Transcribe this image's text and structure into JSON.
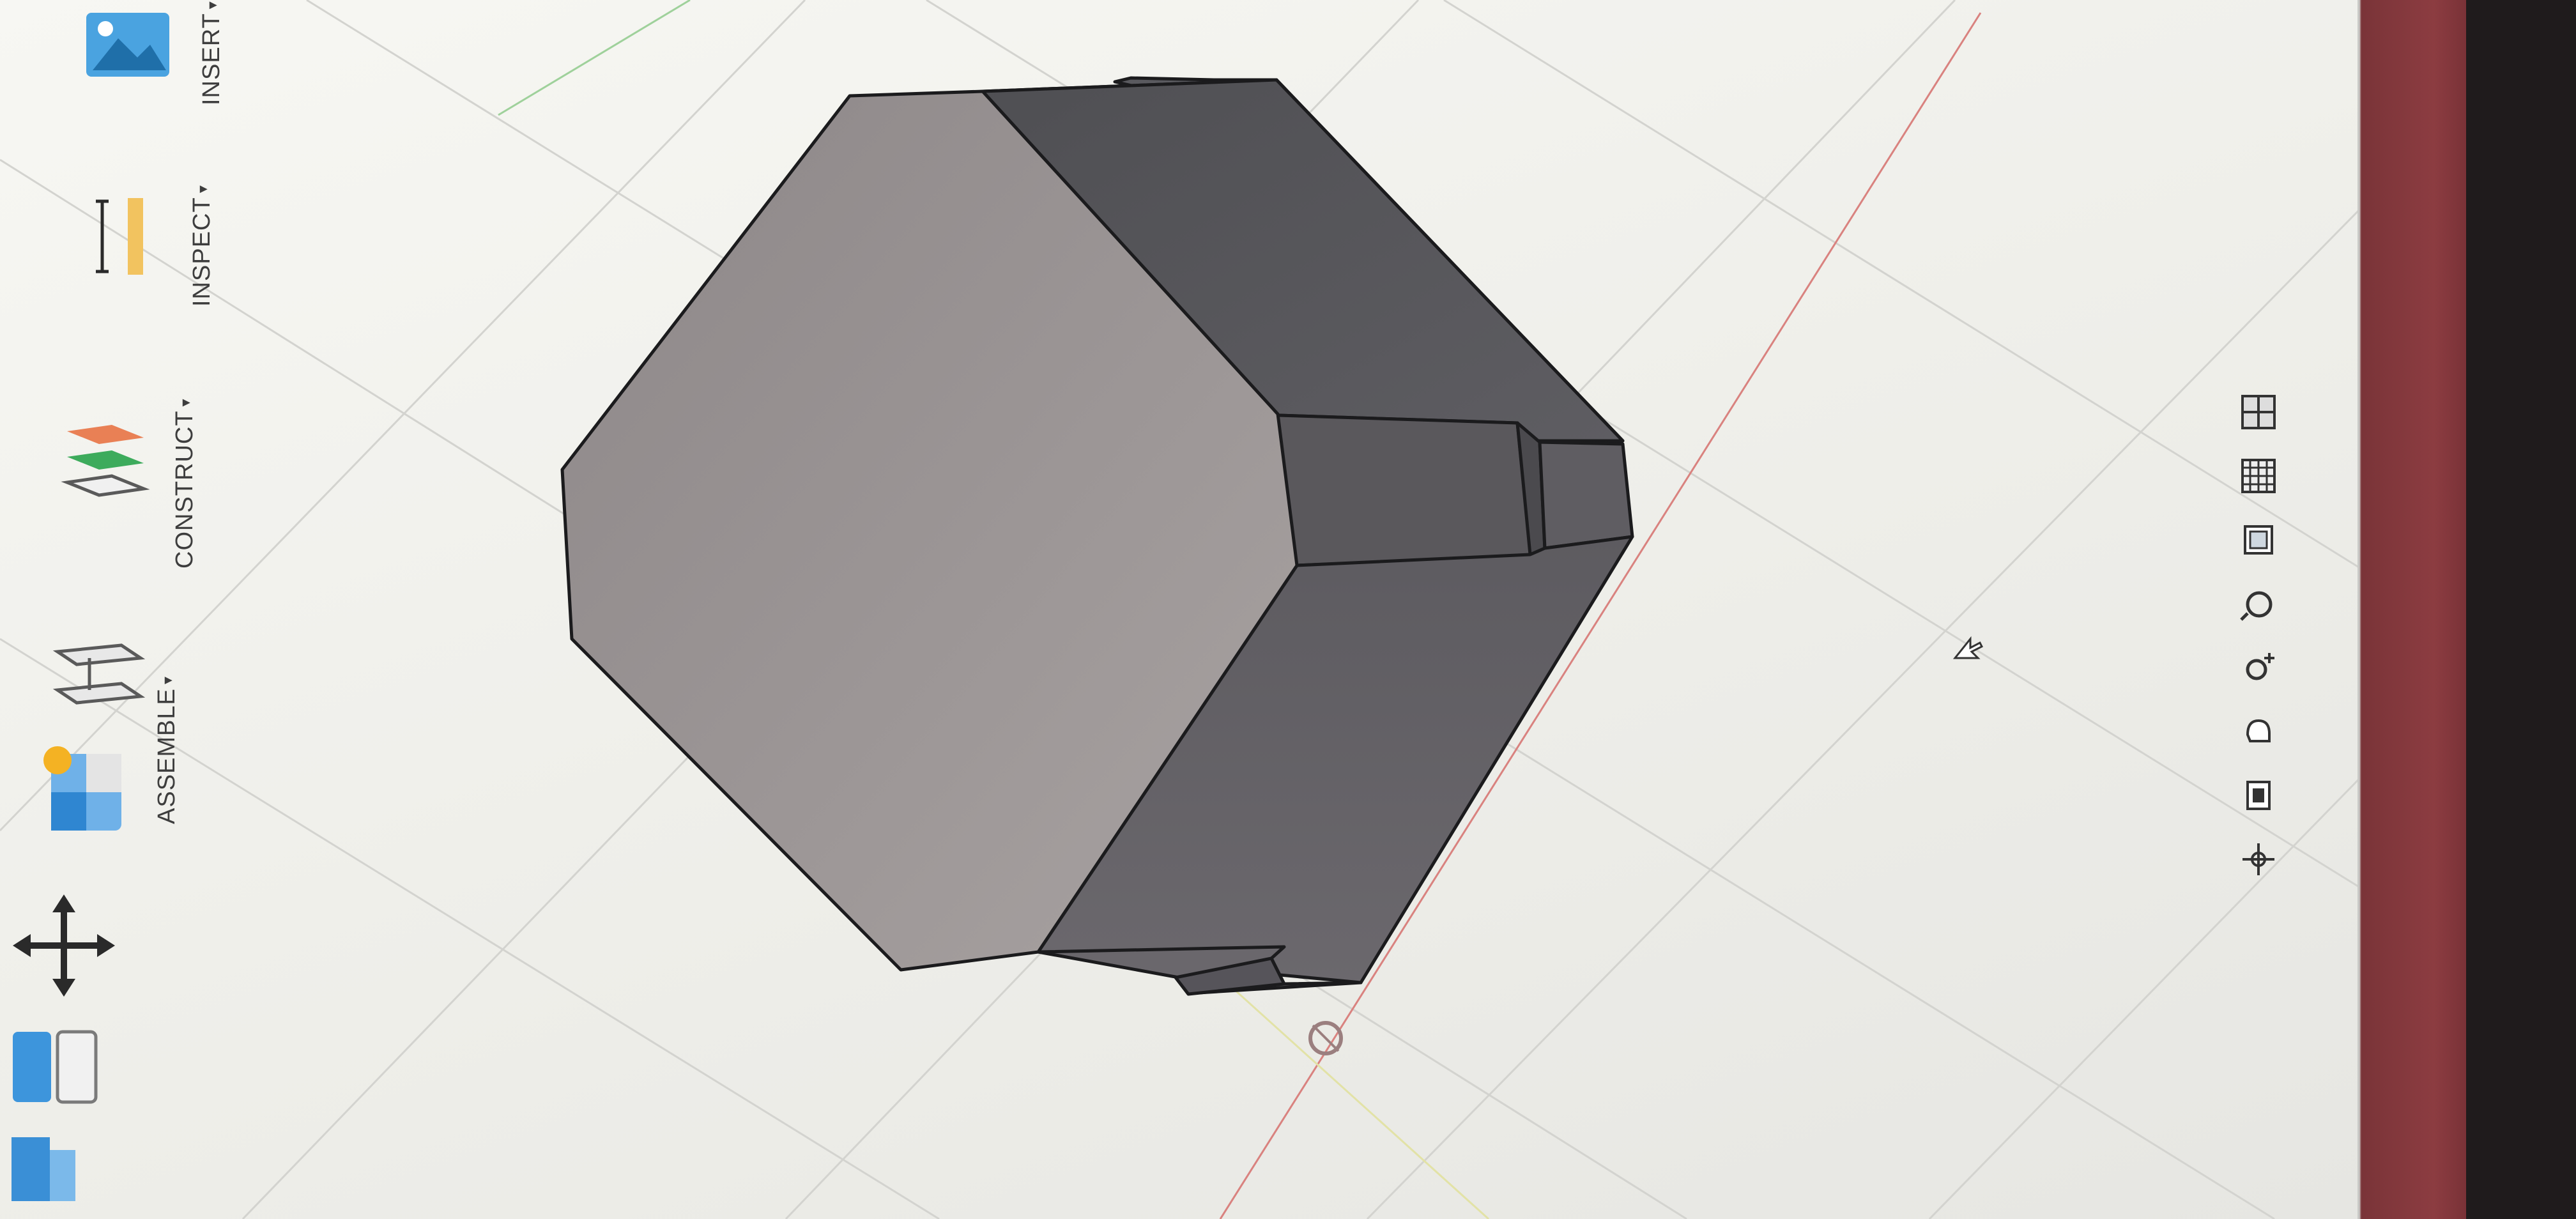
{
  "toolbar": {
    "assemble_label": "ASSEMBLE",
    "construct_label": "CONSTRUCT",
    "inspect_label": "INSPECT",
    "insert_label": "INSERT",
    "dropdown_glyph": "▾",
    "icons": [
      "create-solid-icon",
      "modify-box-icon",
      "move-arrows-icon",
      "new-component-icon",
      "joint-icon",
      "offset-plane-icon",
      "measure-ruler-icon",
      "insert-image-icon"
    ]
  },
  "navigation_bar": {
    "icons": [
      "pan-icon",
      "look-at-icon",
      "hand-orbit-icon",
      "orbit-icon",
      "zoom-fit-icon",
      "display-settings-icon",
      "grid-settings-icon",
      "viewports-icon"
    ]
  },
  "model": {
    "shape": "hexagonal-prism-with-slots",
    "colors": {
      "top_face": "#9a9494",
      "side_face_dark": "#58585c",
      "side_face_mid": "#636267",
      "edge": "#1b1b1d"
    }
  },
  "viewport": {
    "background": "#f2f2ee",
    "grid_color": "#d3d3cf",
    "axis_x_color": "#d9827f",
    "axis_y_color": "#9fd19b"
  }
}
